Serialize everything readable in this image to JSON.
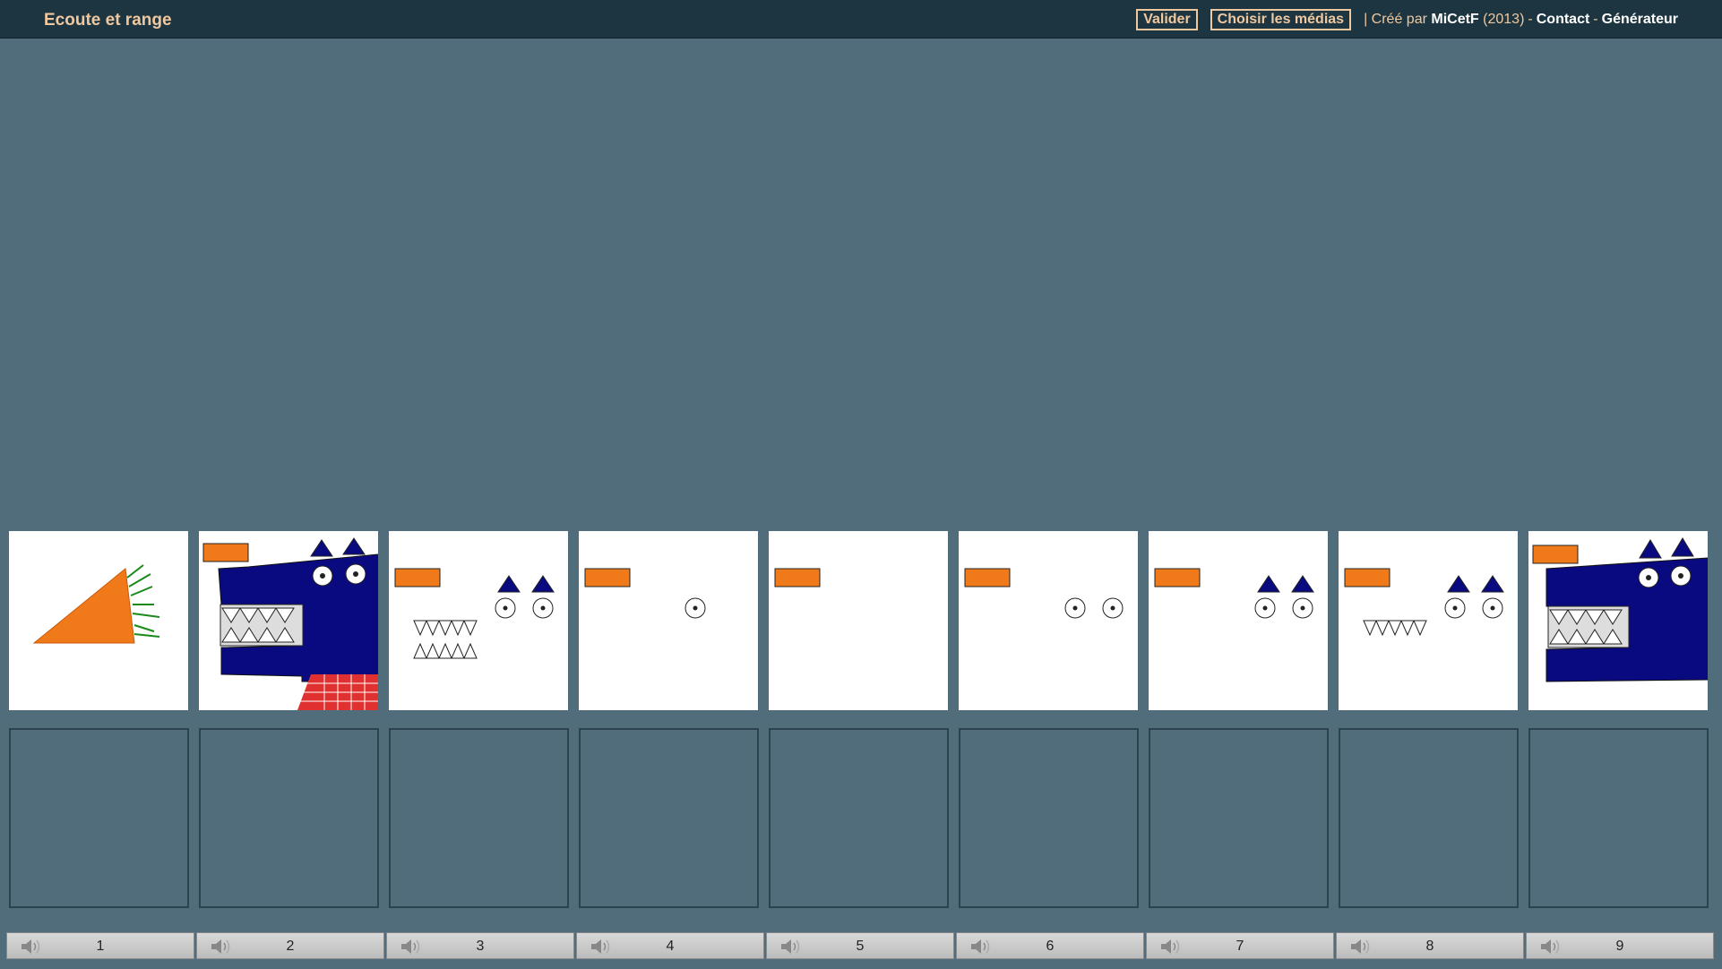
{
  "header": {
    "title": "Ecoute et range",
    "validate_label": "Valider",
    "choose_media_label": "Choisir les médias",
    "created_prefix": "| Créé par",
    "author": "MiCetF",
    "year": "(2013)",
    "dash": "-",
    "contact_label": "Contact",
    "generator_label": "Générateur"
  },
  "cards": [
    {
      "image": "carrot-image"
    },
    {
      "image": "wolf-full-image"
    },
    {
      "image": "wolf-eyes-ears-teeth-image"
    },
    {
      "image": "wolf-one-eye-image"
    },
    {
      "image": "wolf-nose-only-image"
    },
    {
      "image": "wolf-two-eyes-image"
    },
    {
      "image": "wolf-eyes-ears-image"
    },
    {
      "image": "wolf-eyes-ears-lower-teeth-image"
    },
    {
      "image": "wolf-head-image"
    }
  ],
  "sounds": [
    {
      "label": "1",
      "icon": "speaker-icon"
    },
    {
      "label": "2",
      "icon": "speaker-icon"
    },
    {
      "label": "3",
      "icon": "speaker-icon"
    },
    {
      "label": "4",
      "icon": "speaker-icon"
    },
    {
      "label": "5",
      "icon": "speaker-icon"
    },
    {
      "label": "6",
      "icon": "speaker-icon"
    },
    {
      "label": "7",
      "icon": "speaker-icon"
    },
    {
      "label": "8",
      "icon": "speaker-icon"
    },
    {
      "label": "9",
      "icon": "speaker-icon"
    }
  ],
  "colors": {
    "background": "#516d7c",
    "topbar": "#1d3540",
    "accent": "#f0c8a0",
    "wolf_blue": "#0a0a80",
    "nose_orange": "#f07a1a"
  }
}
